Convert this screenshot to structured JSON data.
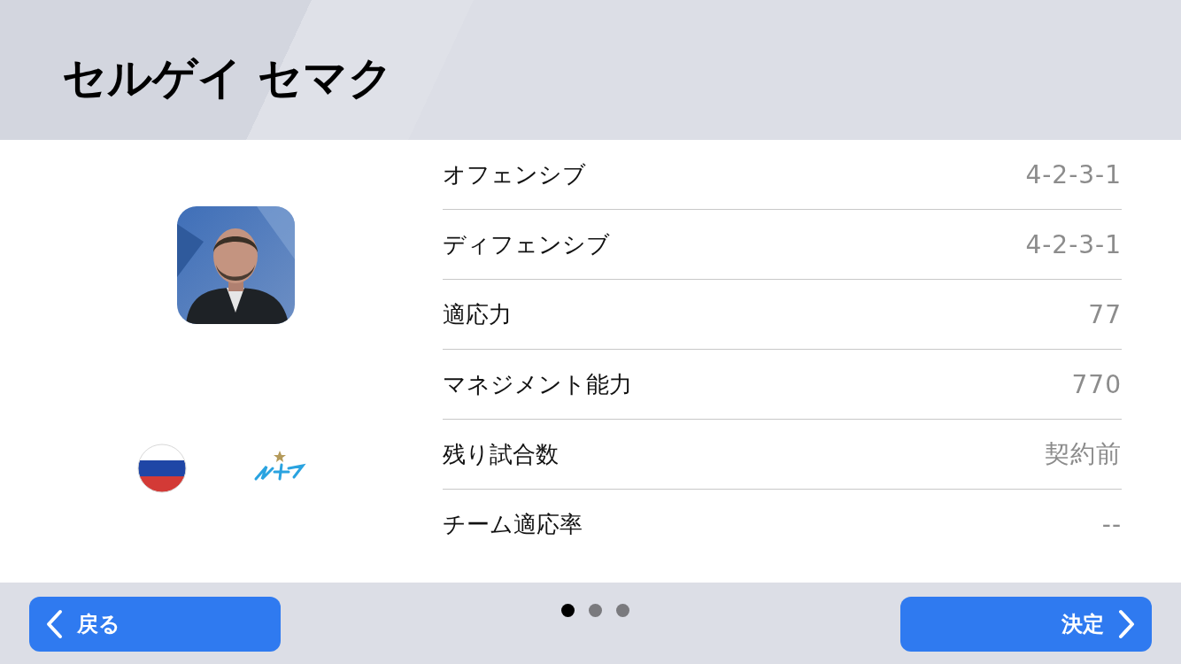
{
  "title": "セルゲイ セマク",
  "stats": [
    {
      "label": "オフェンシブ",
      "value": "4-2-3-1"
    },
    {
      "label": "ディフェンシブ",
      "value": "4-2-3-1"
    },
    {
      "label": "適応力",
      "value": "77"
    },
    {
      "label": "マネジメント能力",
      "value": "770"
    },
    {
      "label": "残り試合数",
      "value": "契約前"
    },
    {
      "label": "チーム適応率",
      "value": "--"
    }
  ],
  "page_dots": [
    {
      "selected": true
    },
    {
      "selected": false
    },
    {
      "selected": false
    }
  ],
  "back_button": {
    "label": "戻る"
  },
  "confirm_button": {
    "label": "決定"
  }
}
